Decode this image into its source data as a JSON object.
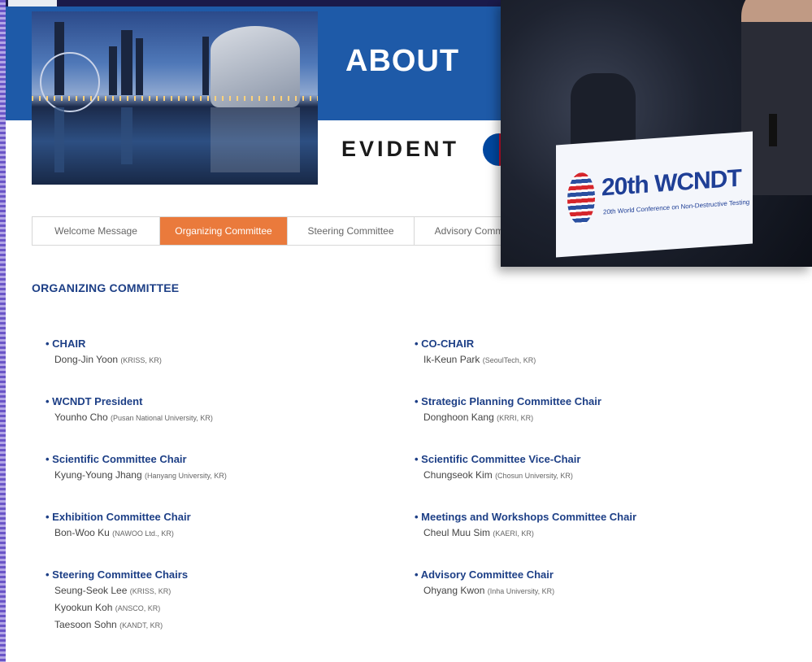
{
  "page": {
    "title": "ABOUT"
  },
  "sponsor": {
    "name": "EVIDENT"
  },
  "tabs": [
    {
      "label": "Welcome Message",
      "active": false
    },
    {
      "label": "Organizing Committee",
      "active": true
    },
    {
      "label": "Steering Committee",
      "active": false
    },
    {
      "label": "Advisory Committe",
      "active": false
    }
  ],
  "section": {
    "title": "ORGANIZING COMMITTEE"
  },
  "roles": [
    {
      "title": "CHAIR",
      "members": [
        {
          "name": "Dong-Jin Yoon",
          "aff": "(KRISS, KR)"
        }
      ]
    },
    {
      "title": "CO-CHAIR",
      "members": [
        {
          "name": "Ik-Keun Park",
          "aff": "(SeoulTech, KR)"
        }
      ]
    },
    {
      "title": "WCNDT President",
      "members": [
        {
          "name": "Younho Cho",
          "aff": "(Pusan National University, KR)"
        }
      ]
    },
    {
      "title": "Strategic Planning Committee Chair",
      "members": [
        {
          "name": "Donghoon Kang",
          "aff": "(KRRI, KR)"
        }
      ]
    },
    {
      "title": "Scientific Committee Chair",
      "members": [
        {
          "name": "Kyung-Young Jhang",
          "aff": "(Hanyang University, KR)"
        }
      ]
    },
    {
      "title": "Scientific Committee Vice-Chair",
      "members": [
        {
          "name": "Chungseok Kim",
          "aff": "(Chosun University, KR)"
        }
      ]
    },
    {
      "title": "Exhibition Committee Chair",
      "members": [
        {
          "name": "Bon-Woo Ku",
          "aff": "(NAWOO Ltd., KR)"
        }
      ]
    },
    {
      "title": "Meetings and Workshops Committee Chair",
      "members": [
        {
          "name": "Cheul Muu Sim",
          "aff": "(KAERI, KR)"
        }
      ]
    },
    {
      "title": "Steering Committee Chairs",
      "members": [
        {
          "name": "Seung-Seok Lee",
          "aff": "(KRISS, KR)"
        },
        {
          "name": "Kyookun Koh",
          "aff": "(ANSCO, KR)"
        },
        {
          "name": "Taesoon Sohn",
          "aff": "(KANDT, KR)"
        }
      ]
    },
    {
      "title": "Advisory Committee Chair",
      "members": [
        {
          "name": "Ohyang Kwon",
          "aff": "(Inha University, KR)"
        }
      ]
    }
  ],
  "overlay_photo": {
    "sign_title": "20th WCNDT",
    "sign_subtitle": "20th World Conference on Non-Destructive Testing"
  },
  "colors": {
    "accent": "#ea7a3c",
    "brand_blue": "#1e5aa8",
    "heading_blue": "#1d3f86"
  }
}
